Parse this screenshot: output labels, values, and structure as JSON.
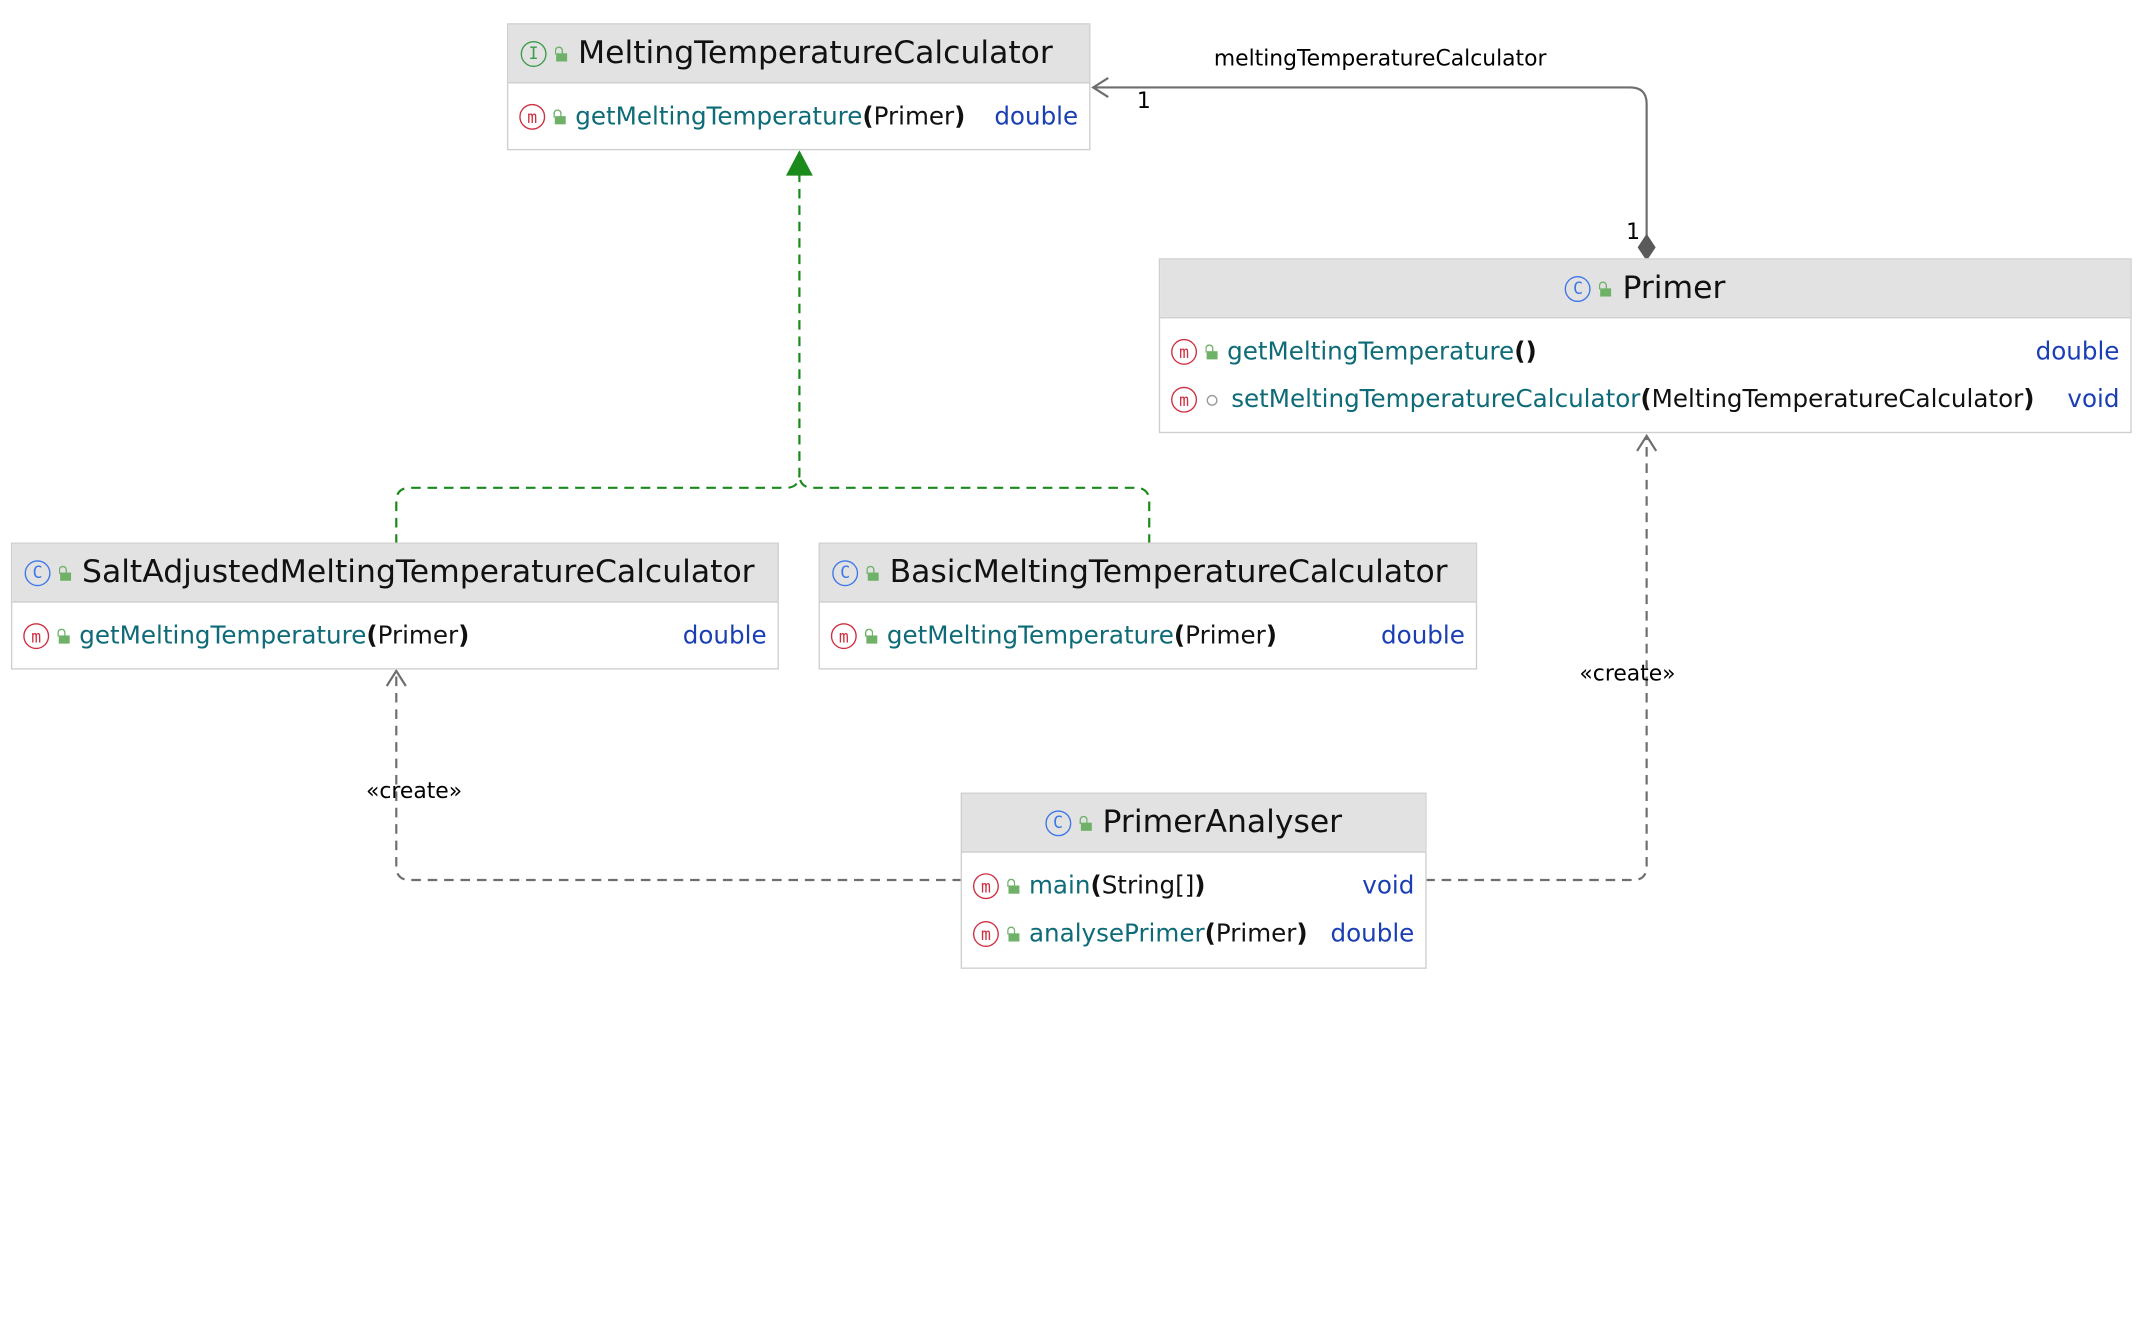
{
  "classes": {
    "mtc": {
      "name": "MeltingTemperatureCalculator",
      "kind_icon": "interface-icon",
      "methods": [
        {
          "name": "getMeltingTemperature",
          "params": "Primer",
          "returns": "double",
          "visibility": "public"
        }
      ]
    },
    "primer": {
      "name": "Primer",
      "kind_icon": "class-icon",
      "methods": [
        {
          "name": "getMeltingTemperature",
          "params": "",
          "returns": "double",
          "visibility": "public"
        },
        {
          "name": "setMeltingTemperatureCalculator",
          "params": "MeltingTemperatureCalculator",
          "returns": "void",
          "visibility": "package-private"
        }
      ]
    },
    "salt": {
      "name": "SaltAdjustedMeltingTemperatureCalculator",
      "kind_icon": "class-icon",
      "methods": [
        {
          "name": "getMeltingTemperature",
          "params": "Primer",
          "returns": "double",
          "visibility": "public"
        }
      ]
    },
    "basic": {
      "name": "BasicMeltingTemperatureCalculator",
      "kind_icon": "class-icon",
      "methods": [
        {
          "name": "getMeltingTemperature",
          "params": "Primer",
          "returns": "double",
          "visibility": "public"
        }
      ]
    },
    "analyser": {
      "name": "PrimerAnalyser",
      "kind_icon": "class-icon",
      "methods": [
        {
          "name": "main",
          "params": "String[]",
          "returns": "void",
          "visibility": "public"
        },
        {
          "name": "analysePrimer",
          "params": "Primer",
          "returns": "double",
          "visibility": "public"
        }
      ]
    }
  },
  "relations": {
    "association": {
      "label": "meltingTemperatureCalculator",
      "target_multiplicity": "1",
      "source_multiplicity": "1",
      "type": "composition"
    },
    "implements": {
      "type": "realization",
      "from": [
        "SaltAdjustedMeltingTemperatureCalculator",
        "BasicMeltingTemperatureCalculator"
      ],
      "to": "MeltingTemperatureCalculator"
    },
    "create_salt": {
      "label": "«create»",
      "type": "dependency"
    },
    "create_primer": {
      "label": "«create»",
      "type": "dependency"
    }
  },
  "icons": {
    "class": "C",
    "interface": "I",
    "method": "m"
  },
  "colors": {
    "realization": "#1a8a1a",
    "dependency": "#6e6e6e",
    "method_name": "#0e6b77",
    "return_type": "#1a3fb5",
    "header_bg": "#e2e2e2"
  }
}
